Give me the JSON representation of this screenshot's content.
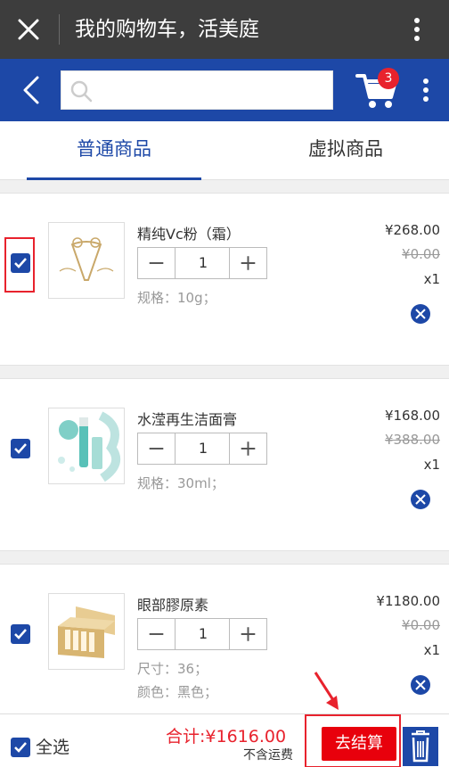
{
  "window": {
    "title": "我的购物车，活美庭"
  },
  "header": {
    "search_placeholder": "",
    "cart_count": "3"
  },
  "tabs": [
    {
      "label": "普通商品",
      "active": true
    },
    {
      "label": "虚拟商品",
      "active": false
    }
  ],
  "items": [
    {
      "name": "精纯Vc粉（霜）",
      "quantity": "1",
      "specs": [
        "规格：10g；"
      ],
      "price": "¥268.00",
      "original_price": "¥0.00",
      "count": "x1",
      "checked": true,
      "thumb_icon": "vc-brand-logo"
    },
    {
      "name": "水滢再生洁面膏",
      "quantity": "1",
      "specs": [
        "规格：30ml；"
      ],
      "price": "¥168.00",
      "original_price": "¥388.00",
      "count": "x1",
      "checked": true,
      "thumb_icon": "cleanser-product-image"
    },
    {
      "name": "眼部膠原素",
      "quantity": "1",
      "specs": [
        "尺寸：36；",
        "颜色：黑色；"
      ],
      "price": "¥1180.00",
      "original_price": "¥0.00",
      "count": "x1",
      "checked": true,
      "thumb_icon": "gift-box-product-image"
    }
  ],
  "footer": {
    "select_all_label": "全选",
    "total_label": "合计:",
    "total_value": "¥1616.00",
    "shipping_note": "不含运费",
    "checkout_label": "去结算"
  },
  "colors": {
    "primary": "#1d48a7",
    "titlebar": "#3d3d3d",
    "accent_red": "#e8222d",
    "checkout": "#e8000c"
  }
}
